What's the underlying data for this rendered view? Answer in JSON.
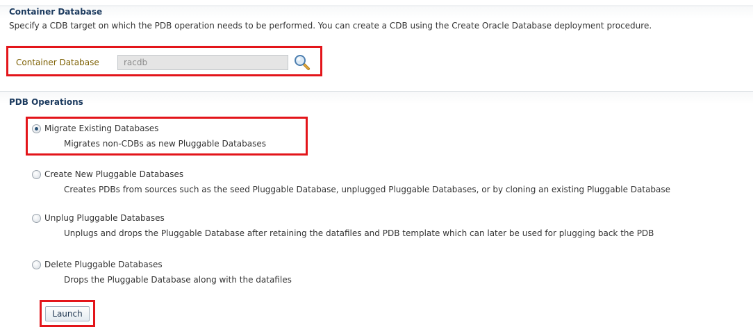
{
  "container_section": {
    "header": "Container Database",
    "description": "Specify a CDB target on which the PDB operation needs to be performed. You can create a CDB using the Create Oracle Database deployment procedure.",
    "field_label": "Container Database",
    "field_value": "racdb",
    "search_icon": "search-icon"
  },
  "pdb_section": {
    "header": "PDB Operations",
    "options": [
      {
        "label": "Migrate Existing Databases",
        "description": "Migrates non-CDBs as new Pluggable Databases",
        "selected": true
      },
      {
        "label": "Create New Pluggable Databases",
        "description": "Creates PDBs from sources such as the seed Pluggable Database, unplugged Pluggable Databases, or by cloning an existing Pluggable Database",
        "selected": false
      },
      {
        "label": "Unplug Pluggable Databases",
        "description": "Unplugs and drops the Pluggable Database after retaining the datafiles and PDB template which can later be used for plugging back the PDB",
        "selected": false
      },
      {
        "label": "Delete Pluggable Databases",
        "description": "Drops the Pluggable Database along with the datafiles",
        "selected": false
      }
    ],
    "launch_label": "Launch"
  },
  "colors": {
    "highlight_border": "#e3151a",
    "header_text": "#1b3a5e",
    "field_label": "#7c5f00",
    "radio_dot": "#2c5478"
  }
}
